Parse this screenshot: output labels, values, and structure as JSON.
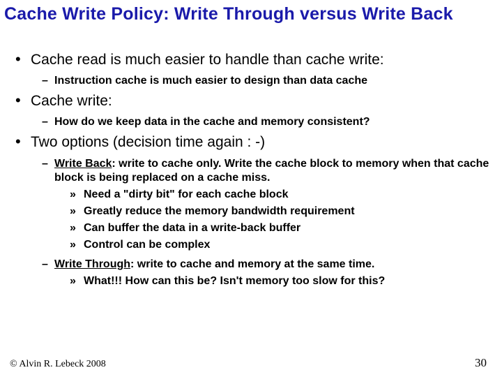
{
  "title": "Cache Write Policy: Write Through versus Write Back",
  "b1": "Cache read is much easier to handle than cache write:",
  "b1_d1": "Instruction cache is much easier to design than data cache",
  "b2": "Cache write:",
  "b2_d1": "How do we keep data in the cache and memory consistent?",
  "b3": "Two options (decision time again : -)",
  "b3_d1_term": "Write Back",
  "b3_d1_rest": ": write to cache only.  Write the cache block to memory when that cache block is being replaced on a cache miss.",
  "b3_d1_c1_a": "Need a ",
  "b3_d1_c1_b": "\"dirty bit\"",
  "b3_d1_c1_c": " for each cache block",
  "b3_d1_c2": "Greatly reduce the memory bandwidth requirement",
  "b3_d1_c3": "Can buffer the data in a write-back buffer",
  "b3_d1_c4": "Control can be complex",
  "b3_d2_term": "Write Through",
  "b3_d2_rest": ": write to cache and memory at the same time.",
  "b3_d2_c1": "What!!! How can this be?  Isn't memory too slow for this?",
  "footer": "© Alvin R. Lebeck 2008",
  "page": "30"
}
